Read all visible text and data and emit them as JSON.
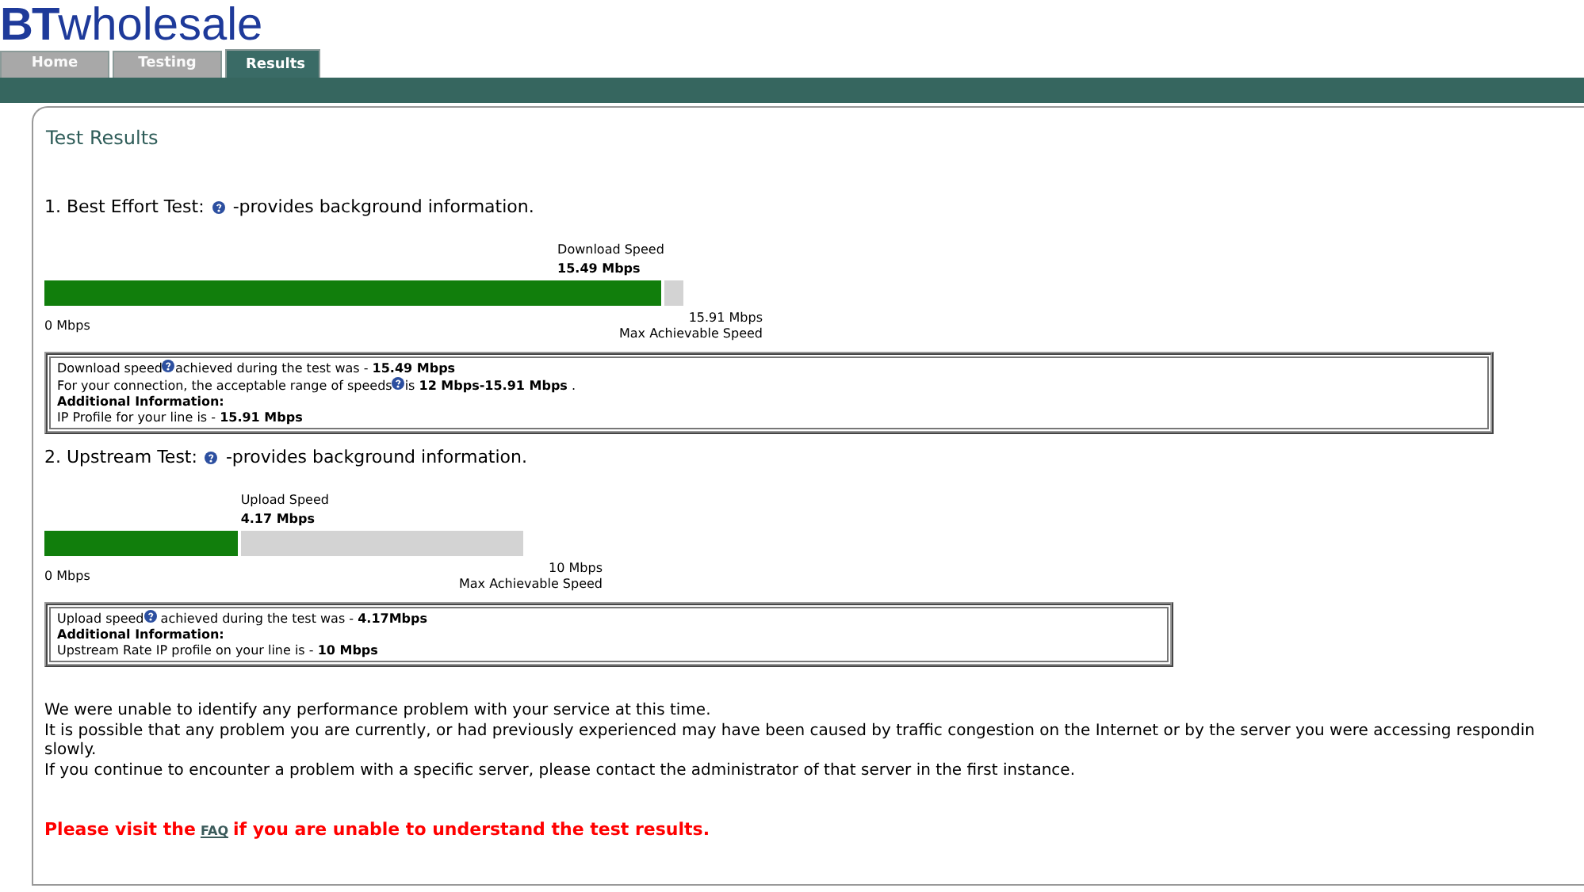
{
  "logo": {
    "brand": "BT",
    "name": "wholesale"
  },
  "tabs": [
    {
      "label": "Home",
      "selected": false
    },
    {
      "label": "Testing",
      "selected": false
    },
    {
      "label": "Results",
      "selected": true
    }
  ],
  "title": "Test Results",
  "tests": [
    {
      "heading_before": "1. Best Effort Test:",
      "heading_after": "-provides background information.",
      "speed_label": "Download Speed",
      "speed_value": "15.49 Mbps",
      "level": 0.97,
      "min_label": "0 Mbps",
      "max_value": "15.91 Mbps",
      "max_label": "Max Achievable Speed",
      "info": [
        {
          "before": "Download speed",
          "help": true,
          "after": "achieved during the test was - **15.49 Mbps**"
        },
        {
          "before": "For your connection, the acceptable range of speeds",
          "help": true,
          "after": "is **12 Mbps-15.91 Mbps** ."
        },
        {
          "before": "**Additional Information:**",
          "help": false
        },
        {
          "before": "IP Profile for your line is - **15.91 Mbps**",
          "help": false
        }
      ]
    },
    {
      "heading_before": "2. Upstream Test:",
      "heading_after": "-provides background information.",
      "speed_label": "Upload Speed",
      "speed_value": "4.17 Mbps",
      "level": 0.41,
      "min_label": "0 Mbps",
      "max_value": "10 Mbps",
      "max_label": "Max Achievable Speed",
      "info": [
        {
          "before": "Upload speed",
          "help": true,
          "after": " achieved during the test was - **4.17Mbps**"
        },
        {
          "before": " **Additional Information:**",
          "help": false
        },
        {
          "before": " Upstream Rate IP profile on your line is - **10 Mbps**",
          "help": false
        }
      ]
    }
  ],
  "messages": [
    "We were unable to identify any performance problem with your service at this time.",
    "It is possible that any problem you are currently, or had previously experienced may have been caused by traffic congestion on the Internet or by the server you were accessing respondin",
    "slowly.",
    "If you continue to encounter a problem with a specific server, please contact the administrator of that server in the first instance."
  ],
  "faq": {
    "before": "Please visit the",
    "link": "FAQ",
    "after": "if you are unable to understand the test results."
  }
}
